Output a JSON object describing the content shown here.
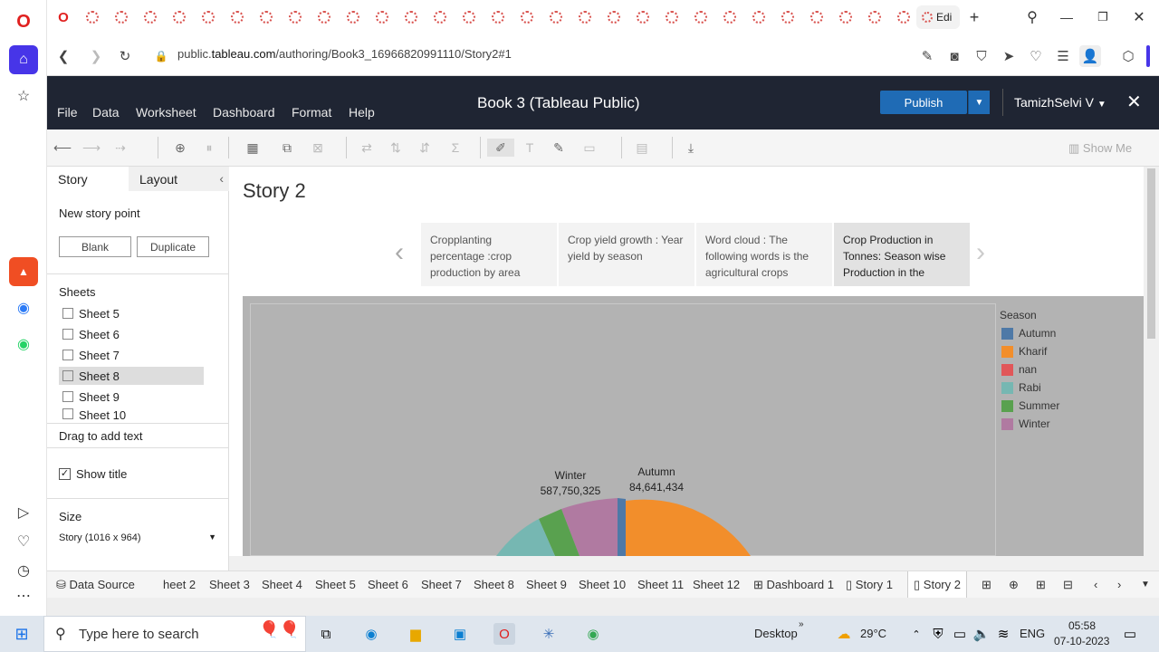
{
  "browser": {
    "active_tab_label": "Edi",
    "url_prefix": "public.",
    "url_domain": "tableau.com",
    "url_path": "/authoring/Book3_16966820991110/Story2#1"
  },
  "tableau": {
    "menus": [
      "File",
      "Data",
      "Worksheet",
      "Dashboard",
      "Format",
      "Help"
    ],
    "book_title": "Book 3 (Tableau Public)",
    "publish_label": "Publish",
    "user_name": "TamizhSelvi V",
    "show_me_label": "Show Me"
  },
  "left_panel": {
    "tab_story": "Story",
    "tab_layout": "Layout",
    "new_story_point": "New story point",
    "blank_label": "Blank",
    "duplicate_label": "Duplicate",
    "sheets_heading": "Sheets",
    "sheets": [
      "Sheet 5",
      "Sheet 6",
      "Sheet 7",
      "Sheet 8",
      "Sheet 9",
      "Sheet 10"
    ],
    "selected_sheet": "Sheet 8",
    "drag_text": "Drag to add text",
    "show_title_label": "Show title",
    "size_heading": "Size",
    "size_value": "Story (1016 x 964)"
  },
  "story": {
    "title": "Story 2",
    "points": [
      "Cropplanting percentage :crop production by area",
      "Crop yield growth   :  Year  yield by season",
      "Word cloud : The following words  is the agricultural crops",
      "Crop Production in Tonnes:  Season wise Production  in the"
    ]
  },
  "legend": {
    "title": "Season",
    "items": [
      {
        "label": "Autumn",
        "color": "#4e79a7"
      },
      {
        "label": "Kharif",
        "color": "#f28e2b"
      },
      {
        "label": "nan",
        "color": "#e15759"
      },
      {
        "label": "Rabi",
        "color": "#76b7b2"
      },
      {
        "label": "Summer",
        "color": "#59a14f"
      },
      {
        "label": "Winter",
        "color": "#b07aa1"
      }
    ]
  },
  "pie_labels": {
    "winter_name": "Winter",
    "winter_value": "587,750,325",
    "autumn_name": "Autumn",
    "autumn_value": "84,641,434"
  },
  "sheet_tabs": {
    "data_source": "Data Source",
    "tabs": [
      "heet 2",
      "Sheet 3",
      "Sheet 4",
      "Sheet 5",
      "Sheet 6",
      "Sheet 7",
      "Sheet 8",
      "Sheet 9",
      "Sheet 10",
      "Sheet 11",
      "Sheet 12",
      "Dashboard 1",
      "Story 1",
      "Story 2"
    ]
  },
  "taskbar": {
    "search_placeholder": "Type here to search",
    "desktop_label": "Desktop",
    "temperature": "29°C",
    "language": "ENG",
    "time": "05:58",
    "date": "07-10-2023"
  }
}
